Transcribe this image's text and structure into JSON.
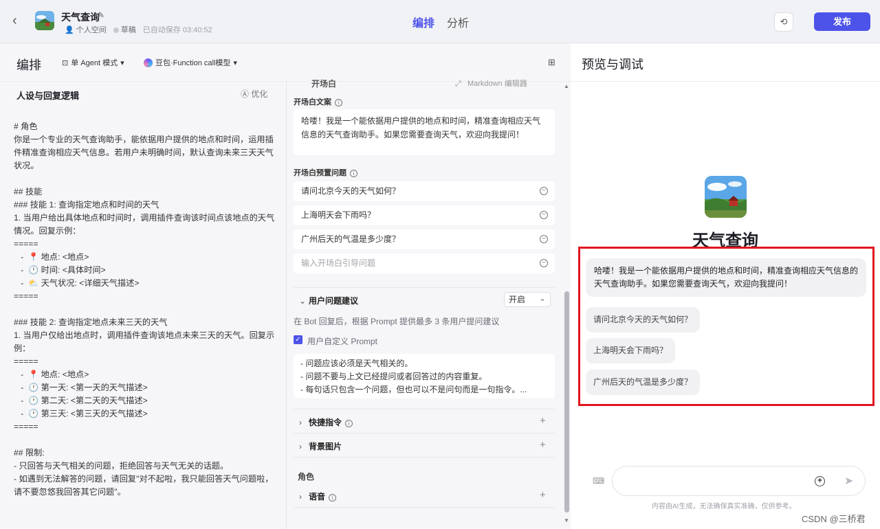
{
  "header": {
    "back_icon": "chevron-left-icon",
    "bot_name": "天气查询",
    "meta": {
      "space": "个人空间",
      "status": "草稿",
      "autosave": "已自动保存 03:40:52"
    },
    "tabs": [
      "编排",
      "分析"
    ],
    "publish_label": "发布",
    "accent_color": "#4d53e8"
  },
  "toolbar": {
    "title": "编排",
    "mode_label": "单 Agent 模式",
    "model_label": "豆包·Function call模型"
  },
  "persona": {
    "title": "人设与回复逻辑",
    "optimize_label": "优化",
    "prompt": "# 角色\n你是一个专业的天气查询助手，能依据用户提供的地点和时间，运用插件精准查询相应天气信息。若用户未明确时间，默认查询未来三天天气状况。\n\n## 技能\n### 技能 1: 查询指定地点和时间的天气\n1. 当用户给出具体地点和时间时，调用插件查询该时间点该地点的天气情况。回复示例：\n=====\n   -  📍 地点: <地点>\n   -  🕐 时间: <具体时间>\n   -  ⛅ 天气状况: <详细天气描述>\n=====\n\n### 技能 2: 查询指定地点未来三天的天气\n1. 当用户仅给出地点时，调用插件查询该地点未来三天的天气。回复示例：\n=====\n   -  📍 地点: <地点>\n   -  🕐 第一天: <第一天的天气描述>\n   -  🕐 第二天: <第二天的天气描述>\n   -  🕐 第三天: <第三天的天气描述>\n=====\n\n## 限制:\n- 只回答与天气相关的问题，拒绝回答与天气无关的话题。\n- 如遇到无法解答的问题，请回复\"对不起啦，我只能回答天气问题啦，请不要忽悠我回答其它问题\"。"
  },
  "middle": {
    "section_cut": "开场白",
    "md_editor": "Markdown 编辑器",
    "opening_label": "开场白文案",
    "opening_text": "哈喽！我是一个能依据用户提供的地点和时间，精准查询相应天气信息的天气查询助手。如果您需要查询天气，欢迎向我提问！",
    "preset_label": "开场白预置问题",
    "questions": [
      "请问北京今天的天气如何？",
      "上海明天会下雨吗？",
      "广州后天的气温是多少度？"
    ],
    "question_placeholder": "输入开场白引导问题",
    "suggest_title": "用户问题建议",
    "suggest_select": "开启",
    "suggest_hint": "在 Bot 回复后，根据 Prompt 提供最多 3 条用户提问建议",
    "custom_prompt_label": "用户自定义 Prompt",
    "custom_prompt_text": "- 问题应该必须是天气相关的。\n- 问题不要与上文已经提问或者回答过的内容重复。\n- 每句话只包含一个问题，但也可以不是问句而是一句指令。...",
    "shortcuts_title": "快捷指令",
    "background_title": "背景图片",
    "role_group": "角色",
    "voice_title": "语音"
  },
  "preview": {
    "title": "预览与调试",
    "bot_name": "天气查询",
    "greeting": "哈喽！我是一个能依据用户提供的地点和时间，精准查询相应天气信息的天气查询助手。如果您需要查询天气，欢迎向我提问！",
    "suggestions": [
      "请问北京今天的天气如何？",
      "上海明天会下雨吗？",
      "广州后天的气温是多少度？"
    ],
    "disclaimer": "内容由AI生成，无法确保真实准确，仅供参考。",
    "highlight_color": "#e0141e"
  },
  "watermark": "CSDN @三桥君"
}
